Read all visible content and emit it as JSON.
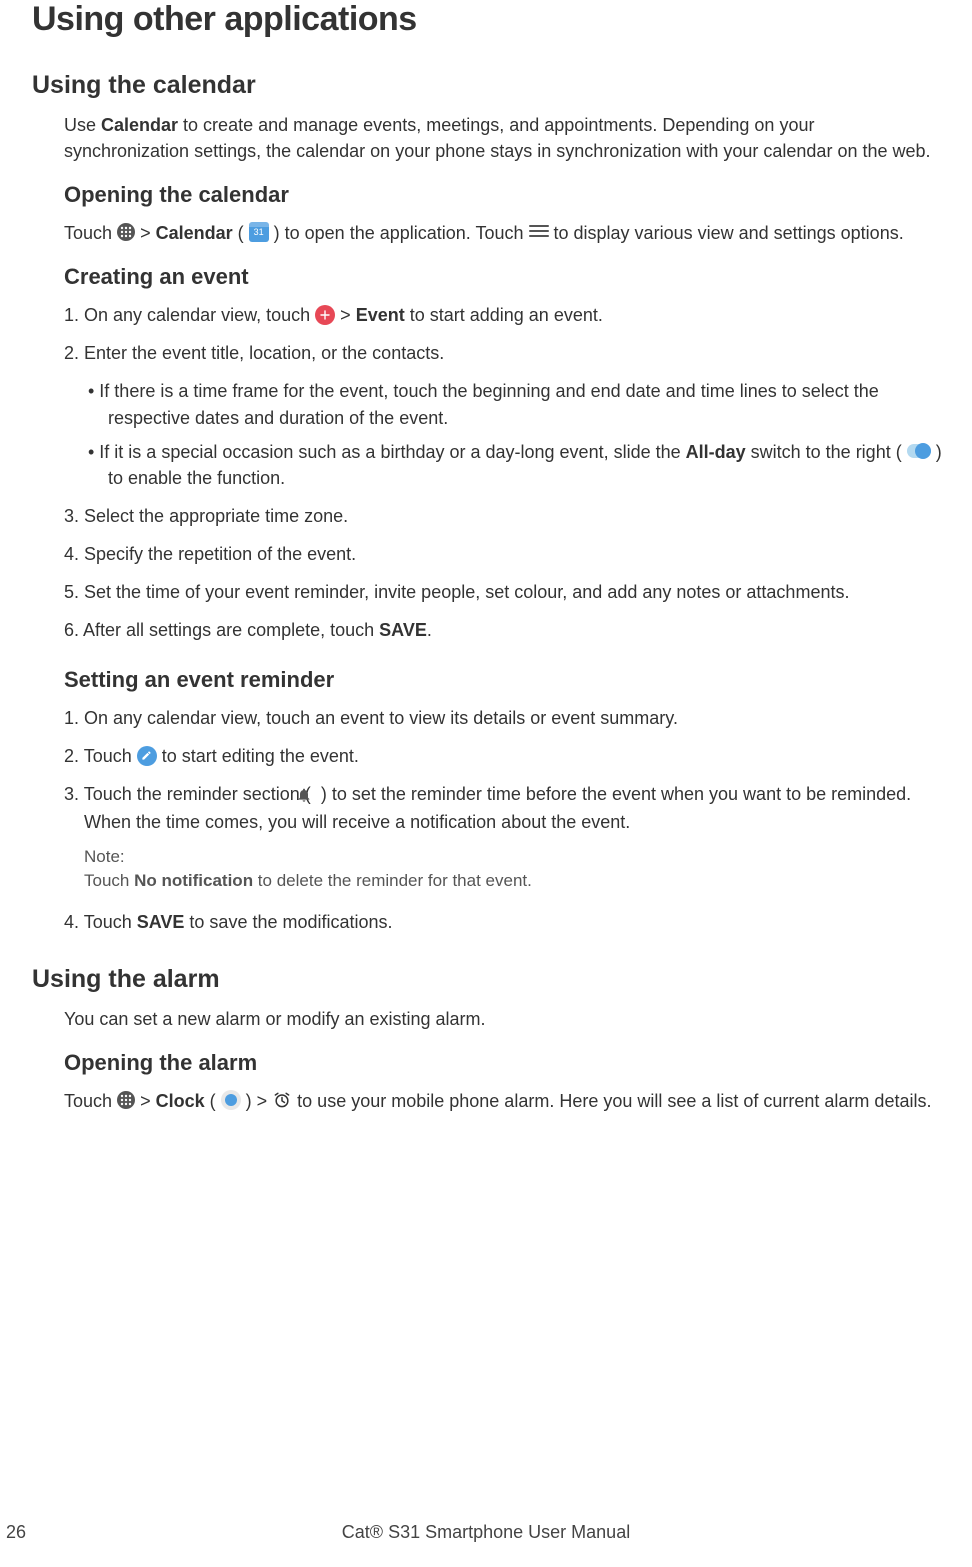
{
  "h1": "Using other applications",
  "calendar": {
    "heading": "Using the calendar",
    "intro_1": "Use ",
    "intro_bold": "Calendar",
    "intro_2": " to create and manage events, meetings, and appointments. Depending on your synchronization settings, the calendar on your phone stays in synchronization with your calendar on the web.",
    "opening": {
      "heading": "Opening the calendar",
      "p1_a": "Touch ",
      "p1_b": " > ",
      "p1_bold": "Calendar",
      "p1_c": " (",
      "p1_day": "31",
      "p1_d": ") to open the application. Touch ",
      "p1_e": " to display various view and settings options."
    },
    "creating": {
      "heading": "Creating an event",
      "s1_a": "1. On any calendar view, touch ",
      "s1_b": " > ",
      "s1_bold": "Event",
      "s1_c": " to start adding an event.",
      "s2": "2. Enter the event title, location, or the contacts.",
      "b1": "•  If there is a time frame for the event, touch the beginning and end date and time lines to select the respective dates and duration of the event.",
      "b2_a": "•  If it is a special occasion such as a birthday or a day-long event, slide the ",
      "b2_bold": "All-day",
      "b2_b": " switch to the right (",
      "b2_c": ") to enable the function.",
      "s3": "3. Select the appropriate time zone.",
      "s4": "4. Specify the repetition of the event.",
      "s5": "5. Set the time of your event reminder, invite people, set colour, and add any notes or attachments.",
      "s6_a": "6. After all settings are complete, touch ",
      "s6_bold": "SAVE",
      "s6_b": "."
    },
    "reminder": {
      "heading": "Setting an event reminder",
      "s1": "1. On any calendar view, touch an event to view its details or event summary.",
      "s2_a": "2. Touch ",
      "s2_b": " to start editing the event.",
      "s3_a": "3. Touch the reminder section (",
      "s3_b": ") to set the reminder time before the event when you want to be reminded. When the time comes, you will receive a notification about the event.",
      "note_label": "Note:",
      "note_a": "Touch ",
      "note_bold": "No notification",
      "note_b": " to delete the reminder for that event.",
      "s4_a": "4. Touch ",
      "s4_bold": "SAVE",
      "s4_b": " to save the modifications."
    }
  },
  "alarm": {
    "heading": "Using the alarm",
    "intro": "You can set a new alarm or modify an existing alarm.",
    "opening": {
      "heading": "Opening the alarm",
      "p_a": "Touch ",
      "p_b": " > ",
      "p_bold": "Clock",
      "p_c": " (",
      "p_d": ") > ",
      "p_e": " to use your mobile phone alarm. Here you will see a list of current alarm details."
    }
  },
  "footer": {
    "page": "26",
    "title": "Cat® S31 Smartphone User Manual"
  }
}
